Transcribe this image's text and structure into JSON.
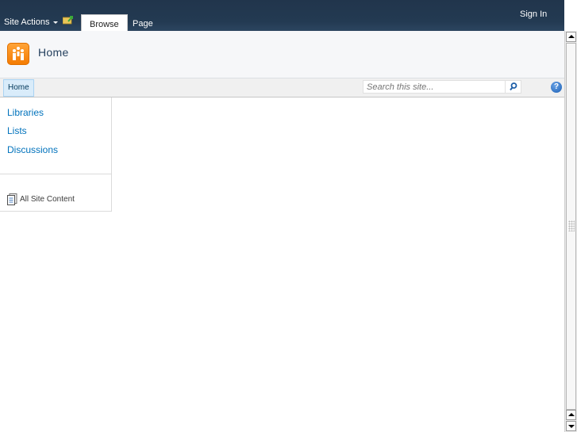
{
  "ribbon": {
    "site_actions": "Site Actions",
    "tabs": [
      {
        "label": "Browse",
        "active": true
      },
      {
        "label": "Page",
        "active": false
      }
    ],
    "sign_in": "Sign In"
  },
  "header": {
    "title": "Home"
  },
  "topnav": {
    "items": [
      {
        "label": "Home",
        "selected": true
      }
    ],
    "search_placeholder": "Search this site...",
    "help_symbol": "?"
  },
  "quicklaunch": {
    "links": [
      {
        "label": "Libraries"
      },
      {
        "label": "Lists"
      },
      {
        "label": "Discussions"
      }
    ],
    "all_site_content": "All Site Content"
  },
  "colors": {
    "ribbon_bg": "#233a52",
    "link": "#0072bc",
    "logo": "#f47a00",
    "title": "#25405e"
  }
}
